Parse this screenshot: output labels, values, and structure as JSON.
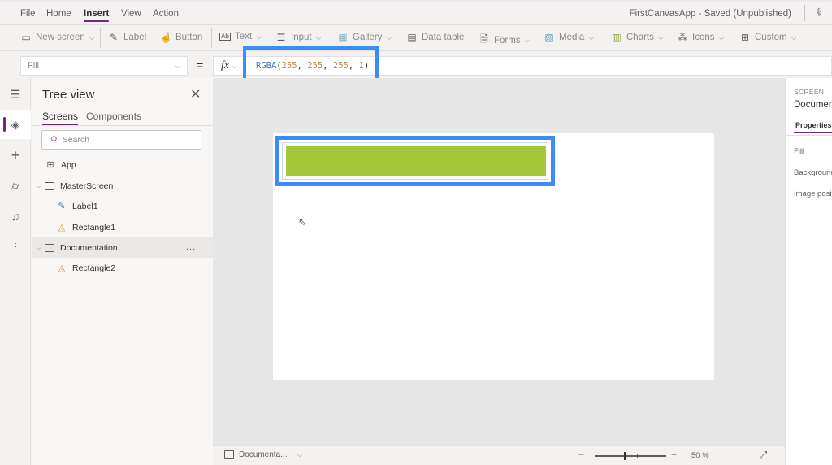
{
  "menubar": {
    "items": [
      "File",
      "Home",
      "Insert",
      "View",
      "Action"
    ],
    "active": "Insert",
    "app_title": "FirstCanvasApp - Saved (Unpublished)"
  },
  "toolbar": {
    "items": [
      {
        "label": "New screen",
        "icon": "new-screen-icon",
        "dropdown": true
      },
      {
        "label": "Label",
        "icon": "label-edit-icon",
        "dropdown": false
      },
      {
        "label": "Button",
        "icon": "button-touch-icon",
        "dropdown": false
      },
      {
        "label": "Text",
        "icon": "text-input-icon",
        "dropdown": true
      },
      {
        "label": "Input",
        "icon": "sliders-icon",
        "dropdown": true
      },
      {
        "label": "Gallery",
        "icon": "gallery-icon",
        "dropdown": true
      },
      {
        "label": "Data table",
        "icon": "table-icon",
        "dropdown": false
      },
      {
        "label": "Forms",
        "icon": "form-icon",
        "dropdown": true
      },
      {
        "label": "Media",
        "icon": "image-icon",
        "dropdown": true
      },
      {
        "label": "Charts",
        "icon": "chart-icon",
        "dropdown": true
      },
      {
        "label": "Icons",
        "icon": "icons-icon",
        "dropdown": true
      },
      {
        "label": "Custom",
        "icon": "custom-component-icon",
        "dropdown": true
      }
    ]
  },
  "formula_bar": {
    "property": "Fill",
    "equals": "=",
    "fx_label": "fx",
    "formula": {
      "function": "RGBA",
      "open": "(",
      "args": [
        "255",
        "255",
        "255",
        "1"
      ],
      "close": ")"
    }
  },
  "left_rail": {
    "icons": [
      "hamburger-menu-icon",
      "tree-view-layers-icon",
      "insert-plus-icon",
      "data-cylinder-icon",
      "media-icon",
      "advanced-tools-icon"
    ],
    "active": "tree-view-layers-icon"
  },
  "tree_view": {
    "title": "Tree view",
    "tabs": [
      "Screens",
      "Components"
    ],
    "active_tab": "Screens",
    "search_placeholder": "Search",
    "app_label": "App",
    "nodes": [
      {
        "label": "MasterScreen",
        "type": "screen",
        "expanded": true,
        "children": [
          {
            "label": "Label1",
            "type": "label"
          },
          {
            "label": "Rectangle1",
            "type": "shape"
          }
        ]
      },
      {
        "label": "Documentation",
        "type": "screen",
        "expanded": true,
        "selected": true,
        "children": [
          {
            "label": "Rectangle2",
            "type": "shape"
          }
        ]
      }
    ],
    "more_label": "..."
  },
  "canvas": {
    "screen_fill": "#ffffff",
    "rectangle_fill": "#a5c63b",
    "highlight_color": "#3c8cf8"
  },
  "bottom_bar": {
    "screen_name": "Documenta...",
    "zoom_minus": "−",
    "zoom_plus": "+",
    "zoom_value": "50 %",
    "zoom_fraction": 0.5
  },
  "properties_panel": {
    "type_label": "SCREEN",
    "name": "Documentation",
    "tab": "Properties",
    "rows": [
      "Fill",
      "Background image",
      "Image position"
    ]
  }
}
